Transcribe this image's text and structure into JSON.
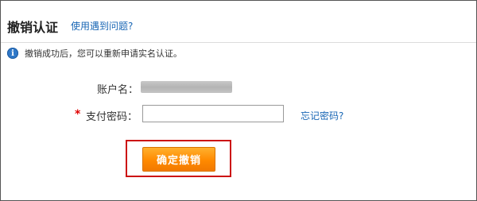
{
  "header": {
    "title": "撤销认证",
    "help_link": "使用遇到问题?"
  },
  "notice": {
    "icon": "info-icon",
    "text": "撤销成功后，您可以重新申请实名认证。"
  },
  "form": {
    "account": {
      "label": "账户名：",
      "value_state": "blurred"
    },
    "payment_password": {
      "required_mark": "*",
      "label": "支付密码：",
      "value": "",
      "placeholder": ""
    },
    "forgot_password_link": "忘记密码?",
    "confirm_button": "确定撤销"
  },
  "colors": {
    "link": "#1a67b5",
    "button": "#ff8a00",
    "highlight": "#cc1111",
    "required": "#e00000",
    "info_icon": "#2f78c8"
  }
}
